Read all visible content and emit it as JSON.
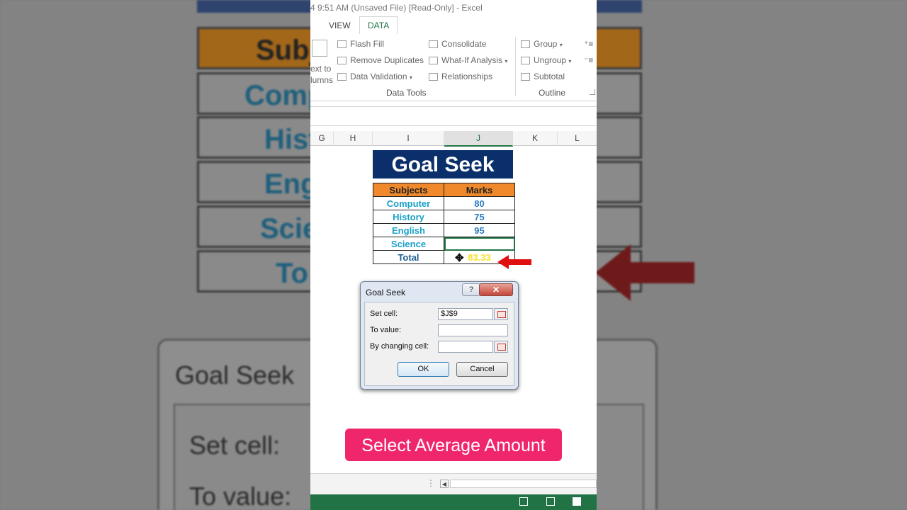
{
  "window": {
    "title": "4 9:51 AM (Unsaved File)  [Read-Only] - Excel"
  },
  "ribbon": {
    "tabs": [
      {
        "label": "VIEW"
      },
      {
        "label": "DATA",
        "active": true
      }
    ],
    "text_to_columns": {
      "line1": "ext to",
      "line2": "lumns"
    },
    "data_tools": {
      "flash_fill": "Flash Fill",
      "remove_duplicates": "Remove Duplicates",
      "data_validation": "Data Validation",
      "consolidate": "Consolidate",
      "what_if": "What-If Analysis",
      "relationships": "Relationships",
      "group_label": "Data Tools"
    },
    "outline": {
      "group": "Group",
      "ungroup": "Ungroup",
      "subtotal": "Subtotal",
      "group_label": "Outline"
    }
  },
  "columns": [
    "G",
    "H",
    "I",
    "J",
    "K",
    "L"
  ],
  "sheet": {
    "title": "Goal Seek",
    "headers": [
      "Subjects",
      "Marks"
    ],
    "rows": [
      {
        "subject": "Computer",
        "marks": "80"
      },
      {
        "subject": "History",
        "marks": "75"
      },
      {
        "subject": "English",
        "marks": "95"
      },
      {
        "subject": "Science",
        "marks": ""
      },
      {
        "subject": "Total",
        "marks": "83.33"
      }
    ]
  },
  "dialog": {
    "title": "Goal Seek",
    "help": "?",
    "close": "✕",
    "set_cell_label": "Set cell:",
    "set_cell_value": "$J$9",
    "to_value_label": "To value:",
    "to_value_value": "",
    "changing_cell_label": "By changing cell:",
    "changing_cell_value": "",
    "ok_label": "OK",
    "cancel_label": "Cancel"
  },
  "caption": "Select Average Amount",
  "background_zoom": {
    "header": "Subj",
    "rows": [
      "Comp",
      "Hist",
      "Eng",
      "Scie",
      "To"
    ],
    "dialog_title": "Goal Seek",
    "set_cell": "Set cell:",
    "to_value": "To value:"
  },
  "colors": {
    "excel_green": "#217346",
    "title_navy": "#0b2f6b",
    "header_orange": "#f0892b",
    "caption_pink": "#f0266d",
    "arrow_red": "#e01010"
  }
}
